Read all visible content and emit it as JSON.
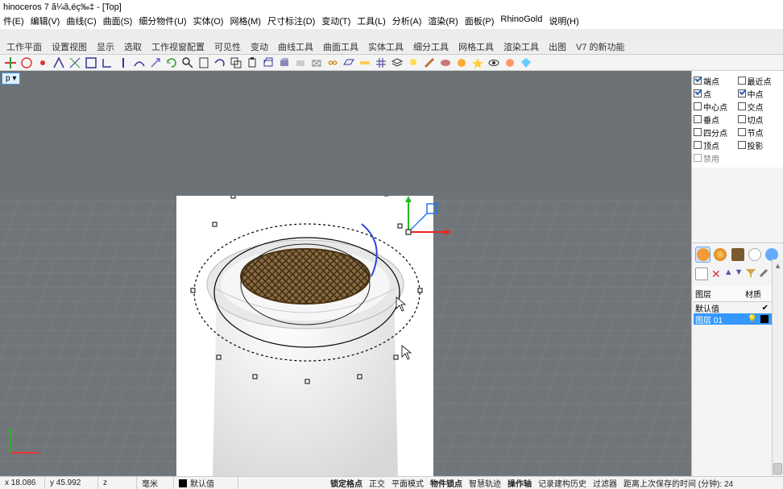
{
  "window": {
    "title": "hinoceros 7 ã¼â,éç‰‡ - [Top]"
  },
  "menubar": [
    "件(E)",
    "编辑(V)",
    "曲线(C)",
    "曲面(S)",
    "细分物件(U)",
    "实体(O)",
    "网格(M)",
    "尺寸标注(D)",
    "变动(T)",
    "工具(L)",
    "分析(A)",
    "渲染(R)",
    "面板(P)",
    "RhinoGold",
    "说明(H)"
  ],
  "tabstrip": [
    "工作平面",
    "设置视图",
    "显示",
    "选取",
    "工作视窗配置",
    "可见性",
    "变动",
    "曲线工具",
    "曲面工具",
    "实体工具",
    "细分工具",
    "网格工具",
    "渲染工具",
    "出图",
    "V7 的新功能"
  ],
  "viewport": {
    "label": "p"
  },
  "osnap": {
    "rows": [
      {
        "l": {
          "chk": true,
          "label": "端点"
        },
        "r": {
          "chk": false,
          "label": "最近点"
        }
      },
      {
        "l": {
          "chk": true,
          "label": "点"
        },
        "r": {
          "chk": true,
          "label": "中点"
        }
      },
      {
        "l": {
          "chk": false,
          "label": "中心点"
        },
        "r": {
          "chk": false,
          "label": "交点"
        }
      },
      {
        "l": {
          "chk": false,
          "label": "垂点"
        },
        "r": {
          "chk": false,
          "label": "切点"
        }
      },
      {
        "l": {
          "chk": false,
          "label": "四分点"
        },
        "r": {
          "chk": false,
          "label": "节点"
        }
      },
      {
        "l": {
          "chk": false,
          "label": "顶点"
        },
        "r": {
          "chk": false,
          "label": "投影"
        }
      }
    ]
  },
  "layers": {
    "hdr": {
      "c1": "图层",
      "c2": "材质"
    },
    "rows": [
      {
        "name": "默认值",
        "current": true,
        "color": "#000",
        "mat": "#fff",
        "sel": false
      },
      {
        "name": "图层 01",
        "current": false,
        "color": "#000",
        "mat": "#29a6ff",
        "sel": true
      }
    ]
  },
  "statusbar": {
    "x": "x 18.086",
    "y": "y 45.992",
    "z": "z",
    "units": "毫米",
    "layer": "默认值",
    "segs": [
      "锁定格点",
      "正交",
      "平面模式",
      "物件锁点",
      "智慧轨迹",
      "操作轴",
      "记录建构历史",
      "过滤器",
      "距离上次保存的时间 (分钟): 24"
    ]
  }
}
